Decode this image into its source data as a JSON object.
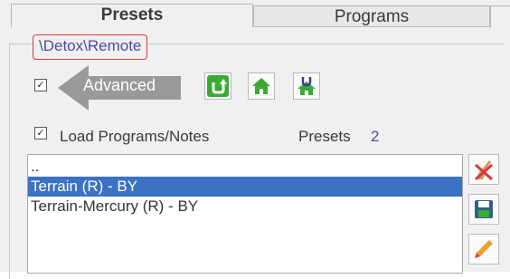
{
  "tabs": [
    {
      "label": "Presets",
      "active": true
    },
    {
      "label": "Programs",
      "active": false
    }
  ],
  "path": "\\Detox\\Remote",
  "advanced": {
    "checked": true,
    "label": "Advanced"
  },
  "toolbar": {
    "icons": [
      "refresh-icon",
      "home-icon",
      "home-u-icon"
    ]
  },
  "load_programs": {
    "checked": true,
    "label": "Load Programs/Notes"
  },
  "presets": {
    "label": "Presets",
    "count": "2"
  },
  "list": {
    "items": [
      "..",
      "Terrain (R) - BY",
      "Terrain-Mercury (R) - BY"
    ],
    "selected_index": 1
  },
  "side_buttons": [
    "broom-delete-icon",
    "save-disk-icon",
    "pencil-edit-icon"
  ],
  "colors": {
    "accent": "#3b72c4",
    "highlight_border": "#d83a3a",
    "green": "#3aaa35"
  }
}
